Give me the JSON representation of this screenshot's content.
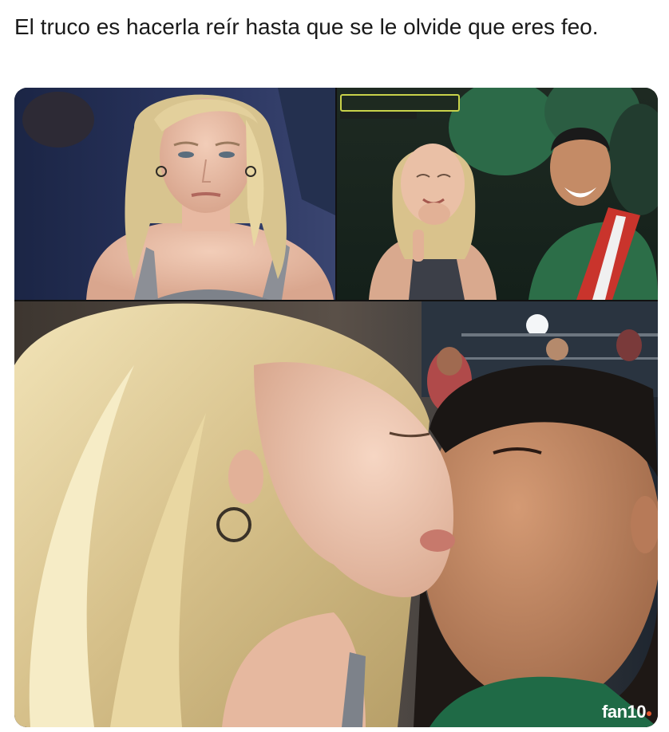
{
  "post": {
    "caption": "El truco es hacerla reír hasta que se le olvide que eres feo."
  },
  "images": {
    "panel_1": "woman-serious-face",
    "panel_2": "woman-laughing-man-smiling-broadcast",
    "panel_3": "couple-kissing-selfie"
  },
  "watermark": {
    "text": "fan10"
  },
  "colors": {
    "background": "#ffffff",
    "text": "#1a1a1a",
    "watermark_dot": "#e4572e"
  }
}
